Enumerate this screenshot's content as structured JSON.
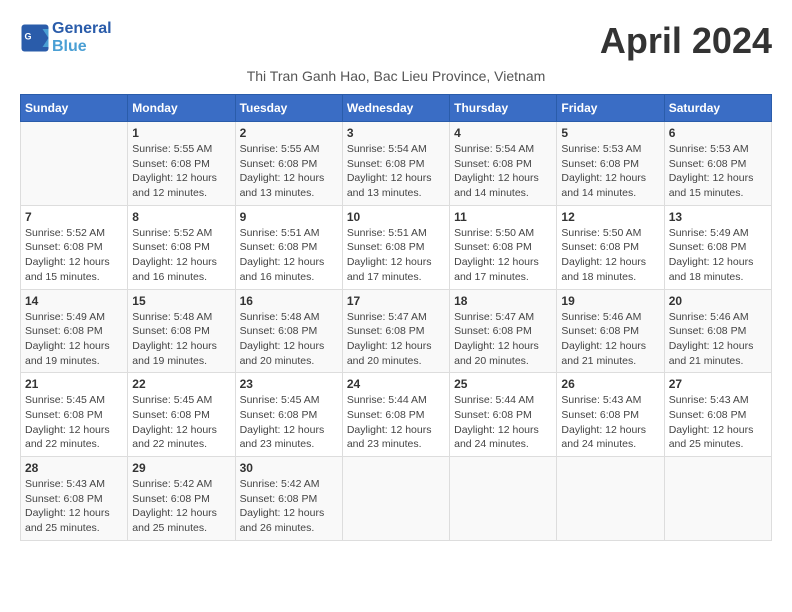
{
  "header": {
    "logo_line1": "General",
    "logo_line2": "Blue",
    "title": "April 2024",
    "location": "Thi Tran Ganh Hao, Bac Lieu Province, Vietnam"
  },
  "weekdays": [
    "Sunday",
    "Monday",
    "Tuesday",
    "Wednesday",
    "Thursday",
    "Friday",
    "Saturday"
  ],
  "weeks": [
    [
      {
        "day": "",
        "info": ""
      },
      {
        "day": "1",
        "info": "Sunrise: 5:55 AM\nSunset: 6:08 PM\nDaylight: 12 hours\nand 12 minutes."
      },
      {
        "day": "2",
        "info": "Sunrise: 5:55 AM\nSunset: 6:08 PM\nDaylight: 12 hours\nand 13 minutes."
      },
      {
        "day": "3",
        "info": "Sunrise: 5:54 AM\nSunset: 6:08 PM\nDaylight: 12 hours\nand 13 minutes."
      },
      {
        "day": "4",
        "info": "Sunrise: 5:54 AM\nSunset: 6:08 PM\nDaylight: 12 hours\nand 14 minutes."
      },
      {
        "day": "5",
        "info": "Sunrise: 5:53 AM\nSunset: 6:08 PM\nDaylight: 12 hours\nand 14 minutes."
      },
      {
        "day": "6",
        "info": "Sunrise: 5:53 AM\nSunset: 6:08 PM\nDaylight: 12 hours\nand 15 minutes."
      }
    ],
    [
      {
        "day": "7",
        "info": "Sunrise: 5:52 AM\nSunset: 6:08 PM\nDaylight: 12 hours\nand 15 minutes."
      },
      {
        "day": "8",
        "info": "Sunrise: 5:52 AM\nSunset: 6:08 PM\nDaylight: 12 hours\nand 16 minutes."
      },
      {
        "day": "9",
        "info": "Sunrise: 5:51 AM\nSunset: 6:08 PM\nDaylight: 12 hours\nand 16 minutes."
      },
      {
        "day": "10",
        "info": "Sunrise: 5:51 AM\nSunset: 6:08 PM\nDaylight: 12 hours\nand 17 minutes."
      },
      {
        "day": "11",
        "info": "Sunrise: 5:50 AM\nSunset: 6:08 PM\nDaylight: 12 hours\nand 17 minutes."
      },
      {
        "day": "12",
        "info": "Sunrise: 5:50 AM\nSunset: 6:08 PM\nDaylight: 12 hours\nand 18 minutes."
      },
      {
        "day": "13",
        "info": "Sunrise: 5:49 AM\nSunset: 6:08 PM\nDaylight: 12 hours\nand 18 minutes."
      }
    ],
    [
      {
        "day": "14",
        "info": "Sunrise: 5:49 AM\nSunset: 6:08 PM\nDaylight: 12 hours\nand 19 minutes."
      },
      {
        "day": "15",
        "info": "Sunrise: 5:48 AM\nSunset: 6:08 PM\nDaylight: 12 hours\nand 19 minutes."
      },
      {
        "day": "16",
        "info": "Sunrise: 5:48 AM\nSunset: 6:08 PM\nDaylight: 12 hours\nand 20 minutes."
      },
      {
        "day": "17",
        "info": "Sunrise: 5:47 AM\nSunset: 6:08 PM\nDaylight: 12 hours\nand 20 minutes."
      },
      {
        "day": "18",
        "info": "Sunrise: 5:47 AM\nSunset: 6:08 PM\nDaylight: 12 hours\nand 20 minutes."
      },
      {
        "day": "19",
        "info": "Sunrise: 5:46 AM\nSunset: 6:08 PM\nDaylight: 12 hours\nand 21 minutes."
      },
      {
        "day": "20",
        "info": "Sunrise: 5:46 AM\nSunset: 6:08 PM\nDaylight: 12 hours\nand 21 minutes."
      }
    ],
    [
      {
        "day": "21",
        "info": "Sunrise: 5:45 AM\nSunset: 6:08 PM\nDaylight: 12 hours\nand 22 minutes."
      },
      {
        "day": "22",
        "info": "Sunrise: 5:45 AM\nSunset: 6:08 PM\nDaylight: 12 hours\nand 22 minutes."
      },
      {
        "day": "23",
        "info": "Sunrise: 5:45 AM\nSunset: 6:08 PM\nDaylight: 12 hours\nand 23 minutes."
      },
      {
        "day": "24",
        "info": "Sunrise: 5:44 AM\nSunset: 6:08 PM\nDaylight: 12 hours\nand 23 minutes."
      },
      {
        "day": "25",
        "info": "Sunrise: 5:44 AM\nSunset: 6:08 PM\nDaylight: 12 hours\nand 24 minutes."
      },
      {
        "day": "26",
        "info": "Sunrise: 5:43 AM\nSunset: 6:08 PM\nDaylight: 12 hours\nand 24 minutes."
      },
      {
        "day": "27",
        "info": "Sunrise: 5:43 AM\nSunset: 6:08 PM\nDaylight: 12 hours\nand 25 minutes."
      }
    ],
    [
      {
        "day": "28",
        "info": "Sunrise: 5:43 AM\nSunset: 6:08 PM\nDaylight: 12 hours\nand 25 minutes."
      },
      {
        "day": "29",
        "info": "Sunrise: 5:42 AM\nSunset: 6:08 PM\nDaylight: 12 hours\nand 25 minutes."
      },
      {
        "day": "30",
        "info": "Sunrise: 5:42 AM\nSunset: 6:08 PM\nDaylight: 12 hours\nand 26 minutes."
      },
      {
        "day": "",
        "info": ""
      },
      {
        "day": "",
        "info": ""
      },
      {
        "day": "",
        "info": ""
      },
      {
        "day": "",
        "info": ""
      }
    ]
  ]
}
